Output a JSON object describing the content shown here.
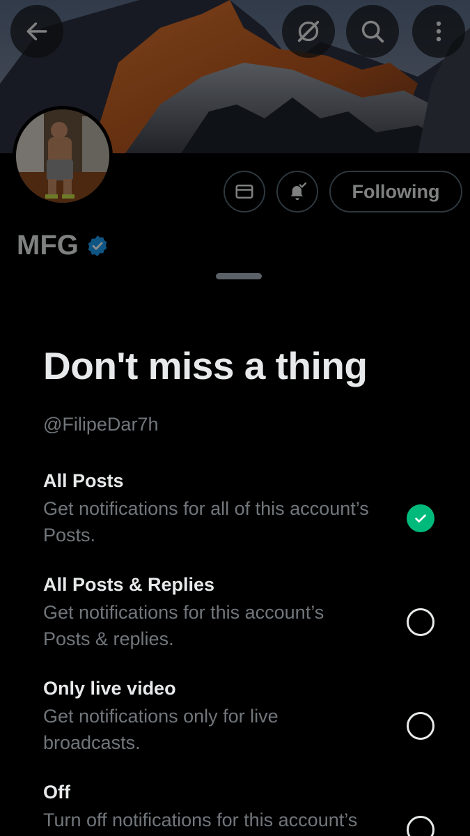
{
  "profile": {
    "display_name": "MFG",
    "following_label": "Following",
    "verified": true
  },
  "icons": {
    "back": "arrow-left-icon",
    "grok": "grok-icon",
    "search": "search-icon",
    "more": "more-vertical-icon",
    "message": "envelope-icon",
    "notifications": "bell-check-icon",
    "verified": "verified-badge-icon",
    "selected": "check-icon"
  },
  "sheet": {
    "title": "Don't miss a thing",
    "handle": "@FilipeDar7h",
    "options": [
      {
        "label": "All Posts",
        "description": "Get notifications for all of this account’s Posts.",
        "selected": true
      },
      {
        "label": "All Posts & Replies",
        "description": "Get notifications for this account’s Posts & replies.",
        "selected": false
      },
      {
        "label": "Only live video",
        "description": "Get notifications only for live broadcasts.",
        "selected": false
      },
      {
        "label": "Off",
        "description": "Turn off notifications for this account’s",
        "selected": false
      }
    ]
  },
  "colors": {
    "accent_green": "#00ba7c",
    "verified_blue": "#1d9bf0",
    "muted_text": "#71767b",
    "border": "#536471"
  }
}
